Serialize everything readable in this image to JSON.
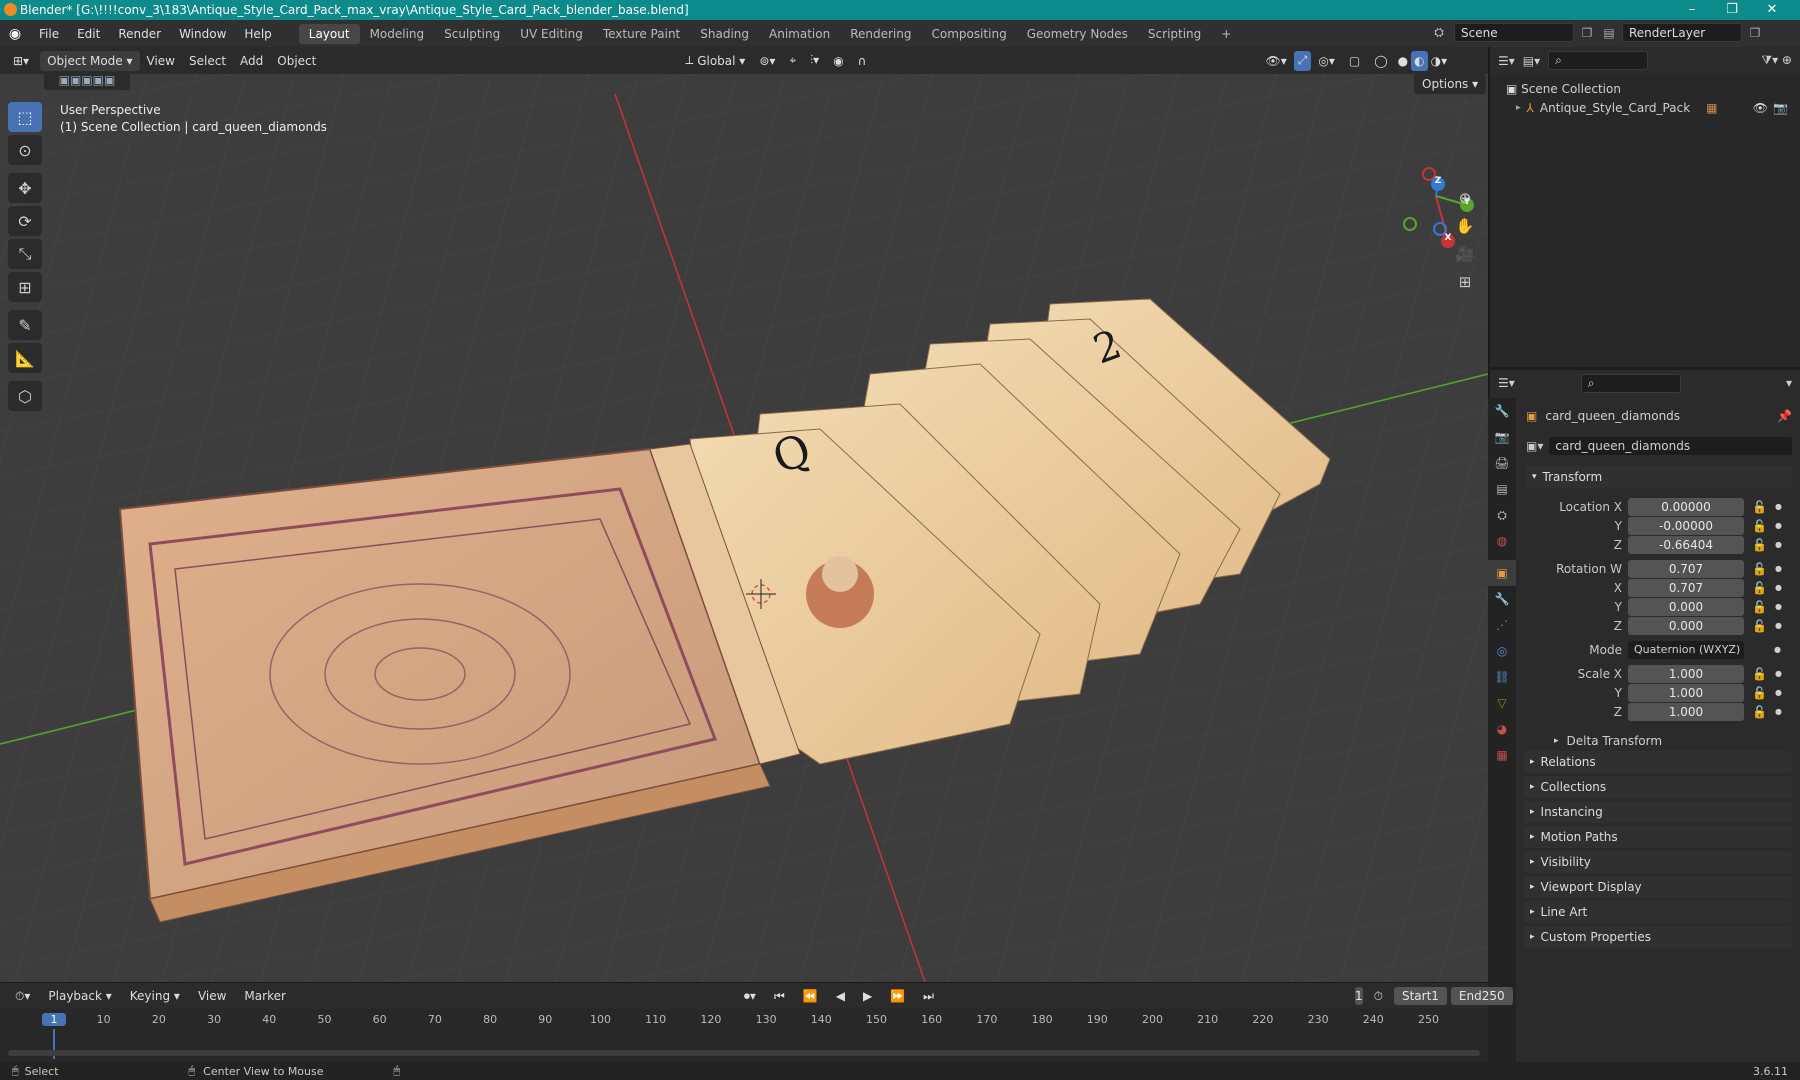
{
  "window": {
    "title": "Blender* [G:\\!!!!conv_3\\183\\Antique_Style_Card_Pack_max_vray\\Antique_Style_Card_Pack_blender_base.blend]",
    "minimize": "–",
    "maximize": "❐",
    "close": "✕"
  },
  "menu": [
    "File",
    "Edit",
    "Render",
    "Window",
    "Help"
  ],
  "workspaces": [
    "Layout",
    "Modeling",
    "Sculpting",
    "UV Editing",
    "Texture Paint",
    "Shading",
    "Animation",
    "Rendering",
    "Compositing",
    "Geometry Nodes",
    "Scripting"
  ],
  "add_workspace": "+",
  "scene": {
    "name": "Scene",
    "render_layer": "RenderLayer"
  },
  "viewport_header": {
    "mode": "Object Mode",
    "menus": [
      "View",
      "Select",
      "Add",
      "Object"
    ],
    "orientation": "Global",
    "options": "Options"
  },
  "viewport": {
    "perspective": "User Perspective",
    "collection_info": "(1) Scene Collection | card_queen_diamonds",
    "gizmo_z": "Z",
    "gizmo_y": "Y",
    "gizmo_x": "X"
  },
  "outliner": {
    "scene_collection": "Scene Collection",
    "items": [
      {
        "name": "Antique_Style_Card_Pack"
      }
    ]
  },
  "properties": {
    "object_name": "card_queen_diamonds",
    "data_name": "card_queen_diamonds",
    "transform_title": "Transform",
    "location_x_label": "Location X",
    "location_x": "0.00000",
    "location_y_label": "Y",
    "location_y": "-0.00000",
    "location_z_label": "Z",
    "location_z": "-0.66404",
    "rotation_w_label": "Rotation W",
    "rotation_w": "0.707",
    "rotation_x_label": "X",
    "rotation_x": "0.707",
    "rotation_y_label": "Y",
    "rotation_y": "0.000",
    "rotation_z_label": "Z",
    "rotation_z": "0.000",
    "mode_label": "Mode",
    "mode_value": "Quaternion (WXYZ)",
    "scale_x_label": "Scale X",
    "scale_x": "1.000",
    "scale_y_label": "Y",
    "scale_y": "1.000",
    "scale_z_label": "Z",
    "scale_z": "1.000",
    "delta_transform": "Delta Transform",
    "panels": [
      "Relations",
      "Collections",
      "Instancing",
      "Motion Paths",
      "Visibility",
      "Viewport Display",
      "Line Art",
      "Custom Properties"
    ]
  },
  "timeline": {
    "menus": [
      "Playback",
      "Keying",
      "View",
      "Marker"
    ],
    "current_frame": "1",
    "start_label": "Start",
    "start": "1",
    "end_label": "End",
    "end": "250",
    "ruler": [
      "1",
      "10",
      "20",
      "30",
      "40",
      "50",
      "60",
      "70",
      "80",
      "90",
      "100",
      "110",
      "120",
      "130",
      "140",
      "150",
      "160",
      "170",
      "180",
      "190",
      "200",
      "210",
      "220",
      "230",
      "240",
      "250"
    ]
  },
  "status": {
    "select": "Select",
    "center": "Center View to Mouse",
    "version": "3.6.11"
  },
  "colors": {
    "accent": "#4772b3",
    "titlebar": "#0d8a8a",
    "axis_x": "#c8333a",
    "axis_y": "#5aa52c",
    "axis_z": "#2f7bd6"
  }
}
